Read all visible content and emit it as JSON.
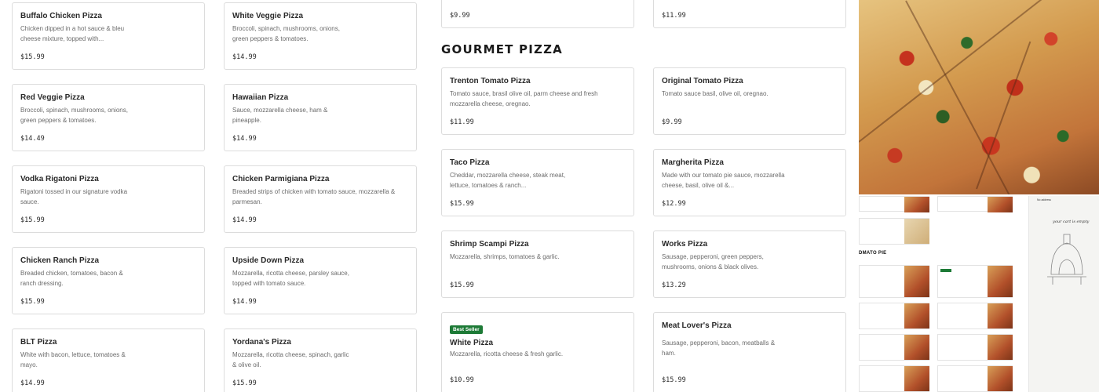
{
  "column1": [
    {
      "name": "Buffalo Chicken Pizza",
      "desc": "Chicken dipped in a hot sauce & bleu cheese mixture, topped with...",
      "price": "$15.99"
    },
    {
      "name": "Red Veggie Pizza",
      "desc": "Broccoli, spinach, mushrooms, onions, green peppers & tomatoes.",
      "price": "$14.49"
    },
    {
      "name": "Vodka Rigatoni Pizza",
      "desc": "Rigatoni tossed in our signature vodka sauce.",
      "price": "$15.99"
    },
    {
      "name": "Chicken Ranch Pizza",
      "desc": "Breaded chicken, tomatoes, bacon & ranch dressing.",
      "price": "$15.99"
    },
    {
      "name": "BLT Pizza",
      "desc": "White with bacon, lettuce, tomatoes & mayo.",
      "price": "$14.99"
    }
  ],
  "column2": [
    {
      "name": "White Veggie Pizza",
      "desc": "Broccoli, spinach, mushrooms, onions, green peppers & tomatoes.",
      "price": "$14.99"
    },
    {
      "name": "Hawaiian Pizza",
      "desc": "Sauce, mozzarella cheese, ham & pineapple.",
      "price": "$14.99"
    },
    {
      "name": "Chicken Parmigiana Pizza",
      "desc": "Breaded strips of chicken with tomato sauce, mozzarella & parmesan.",
      "price": "$14.99"
    },
    {
      "name": "Upside Down Pizza",
      "desc": "Mozzarella, ricotta cheese, parsley sauce, topped with tomato sauce.",
      "price": "$14.99"
    },
    {
      "name": "Yordana's Pizza",
      "desc": "Mozzarella, ricotta cheese, spinach, garlic & olive oil.",
      "price": "$15.99"
    }
  ],
  "top_partial": {
    "left_price": "$9.99",
    "right_price": "$11.99"
  },
  "section_title": "GOURMET PIZZA",
  "gourmet": [
    {
      "name": "Trenton Tomato Pizza",
      "desc": "Tomato sauce, brasil olive oil, parm cheese and fresh mozzarella cheese, oregnao.",
      "price": "$11.99"
    },
    {
      "name": "Original Tomato Pizza",
      "desc": "Tomato sauce basil, olive oil, oregnao.",
      "price": "$9.99"
    },
    {
      "name": "Taco Pizza",
      "desc": "Cheddar, mozzarella cheese, steak meat, lettuce, tomatoes & ranch...",
      "price": "$15.99"
    },
    {
      "name": "Margherita Pizza",
      "desc": "Made with our tomato pie sauce, mozzarella cheese, basil, olive oil &...",
      "price": "$12.99"
    },
    {
      "name": "Shrimp Scampi Pizza",
      "desc": "Mozzarella, shrimps, tomatoes & garlic.",
      "price": "$15.99"
    },
    {
      "name": "Works Pizza",
      "desc": "Sausage, pepperoni, green peppers, mushrooms, onions & black olives.",
      "price": "$13.29"
    },
    {
      "name": "White Pizza",
      "desc": "Mozzarella, ricotta cheese & fresh garlic.",
      "price": "$10.99",
      "badge": "Best Seller"
    },
    {
      "name": "Meat Lover's Pizza",
      "desc": "Sausage, pepperoni, bacon, meatballs & ham.",
      "price": "$15.99"
    }
  ],
  "mini": {
    "title": "DMATO PIE",
    "no_address": "No address",
    "cart_empty": "your cart is empty"
  },
  "colors": {
    "badge": "#1d7a36",
    "border": "#dcdcdc"
  }
}
